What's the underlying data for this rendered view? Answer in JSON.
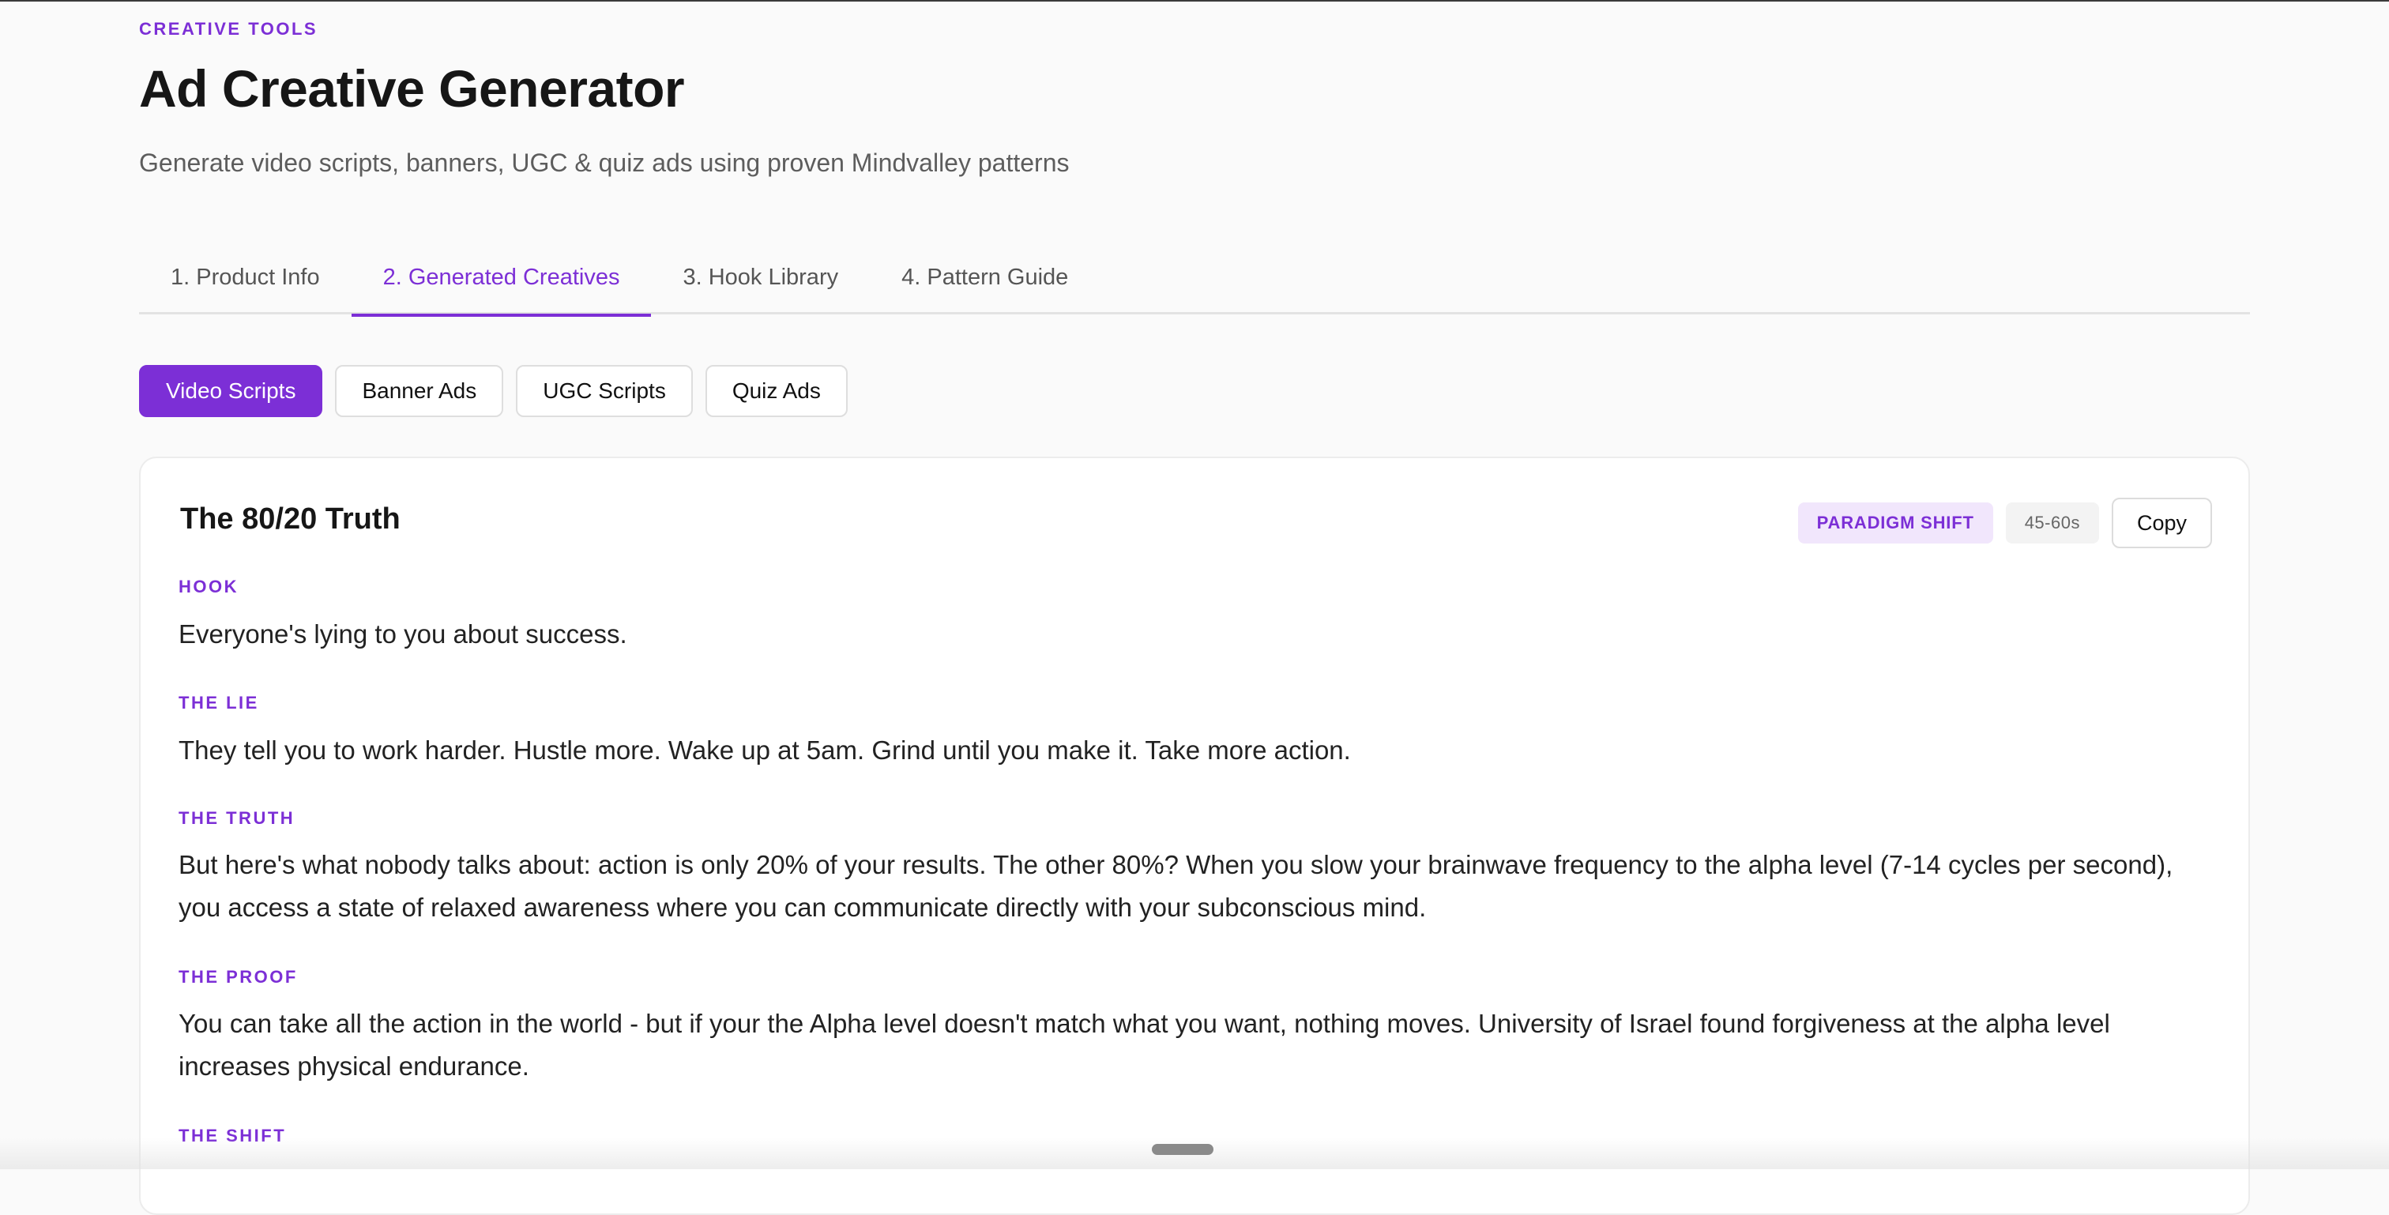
{
  "header": {
    "eyebrow": "CREATIVE TOOLS",
    "title": "Ad Creative Generator",
    "subtitle": "Generate video scripts, banners, UGC & quiz ads using proven Mindvalley patterns"
  },
  "tabs": [
    {
      "label": "1. Product Info",
      "active": false
    },
    {
      "label": "2. Generated Creatives",
      "active": true
    },
    {
      "label": "3. Hook Library",
      "active": false
    },
    {
      "label": "4. Pattern Guide",
      "active": false
    }
  ],
  "subtabs": [
    {
      "label": "Video Scripts",
      "active": true
    },
    {
      "label": "Banner Ads",
      "active": false
    },
    {
      "label": "UGC Scripts",
      "active": false
    },
    {
      "label": "Quiz Ads",
      "active": false
    }
  ],
  "card": {
    "title": "The 80/20 Truth",
    "pattern_badge": "PARADIGM SHIFT",
    "duration_badge": "45-60s",
    "copy_label": "Copy",
    "sections": [
      {
        "label": "HOOK",
        "text": "Everyone's lying to you about success."
      },
      {
        "label": "THE LIE",
        "text": "They tell you to work harder. Hustle more. Wake up at 5am. Grind until you make it. Take more action."
      },
      {
        "label": "THE TRUTH",
        "text": "But here's what nobody talks about: action is only 20% of your results. The other 80%? When you slow your brainwave frequency to the alpha level (7-14 cycles per second), you access a state of relaxed awareness where you can communicate directly with your subconscious mind."
      },
      {
        "label": "THE PROOF",
        "text": "You can take all the action in the world - but if your the Alpha level doesn't match what you want, nothing moves. University of Israel found forgiveness at the alpha level increases physical endurance."
      },
      {
        "label": "THE SHIFT",
        "text": ""
      }
    ]
  },
  "colors": {
    "accent": "#7c2fd6",
    "accent_soft": "#f1e6fc",
    "background": "#fafafa",
    "card": "#ffffff"
  }
}
